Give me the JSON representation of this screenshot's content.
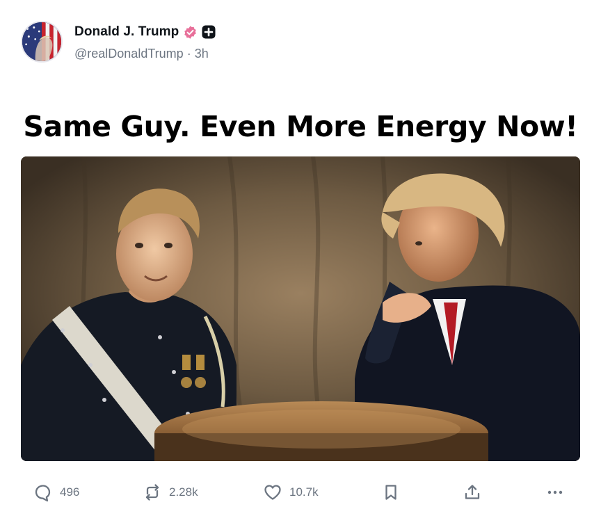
{
  "post": {
    "author": {
      "display_name": "Donald J. Trump",
      "handle": "@realDonaldTrump",
      "time_ago": "3h",
      "verified_badge": "verified-badge-icon",
      "verified_color": "#e8709a",
      "extra_badge": "plus-badge-icon"
    },
    "headline": "Same Guy. Even More Energy Now!",
    "image": {
      "subject": "young-man-in-military-uniform-and-older-man-in-suit-at-table"
    },
    "actions": {
      "replies": {
        "count": "496",
        "icon": "reply-icon"
      },
      "reposts": {
        "count": "2.28k",
        "icon": "repost-icon"
      },
      "likes": {
        "count": "10.7k",
        "icon": "heart-icon"
      },
      "bookmark": {
        "icon": "bookmark-icon"
      },
      "share": {
        "icon": "share-icon"
      },
      "more": {
        "icon": "more-icon"
      }
    },
    "colors": {
      "text_primary": "#0f1419",
      "text_secondary": "#6c7581",
      "icon_gray": "#6c7581"
    }
  }
}
